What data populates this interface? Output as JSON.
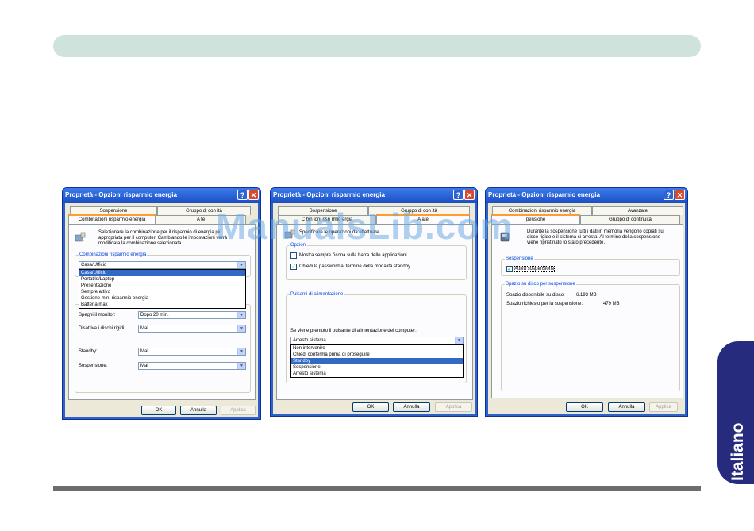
{
  "page": {
    "side_tab_label": "Italiano",
    "watermark": "ManualsLib.com"
  },
  "colors": {
    "top_bar": "#cfe3dc",
    "side_tab": "#262b7e",
    "titlebar": "#2f62c8",
    "highlight": "#316ac5"
  },
  "dialogs": [
    {
      "title": "Proprietà - Opzioni risparmio energia",
      "tabs_back": [
        "Sospensione",
        "Gruppo di con   ità"
      ],
      "tabs_front": [
        "Combinazioni risparmio energia",
        "A    te"
      ],
      "intro": [
        "Selezionare la combinazione per il risparmio di energia più",
        "appropriata per il computer. Cambiando le impostazioni verrà",
        "modificata la combinazione selezionata."
      ],
      "group_label": "Combinazioni risparmio energia",
      "combo_value": "Casa/Ufficio",
      "dropdown": [
        "Casa/Ufficio",
        "Portatile/Laptop",
        "Presentazione",
        "Sempre attivo",
        "Gestione min. risparmio energia",
        "Batteria max"
      ],
      "settings": [
        {
          "label": "Spegni il monitor:",
          "value": "Dopo 20 min."
        },
        {
          "label": "Disattiva i dischi rigidi:",
          "value": "Mai"
        },
        {
          "label": "Standby:",
          "value": "Mai"
        },
        {
          "label": "Sospensione:",
          "value": "Mai"
        }
      ],
      "buttons": [
        "OK",
        "Annulla",
        "Applica"
      ]
    },
    {
      "title": "Proprietà - Opzioni risparmio energia",
      "tabs_back": [
        "Sospensione",
        "Gruppo di con  ità"
      ],
      "tabs_front": [
        "C   bin  ioni risp  rmio   ergia",
        "A    ate"
      ],
      "intro": "Specificare le operazioni da effettuare.",
      "group_options": "Opzioni",
      "checkboxes": [
        {
          "label": "Mostra sempre l'icona sulla barra delle applicazioni.",
          "checked": false
        },
        {
          "label": "Chiedi la password al termine della modalità standby.",
          "checked": true
        }
      ],
      "group_power": "Pulsanti di alimentazione",
      "power_prompt": "Se viene premuto il pulsante di alimentazione del computer:",
      "combo_value": "Arresto sistema",
      "dropdown": [
        "Non intervenire",
        "Chiedi conferma prima di proseguire",
        "Standby",
        "Sospensione",
        "Arresto sistema"
      ],
      "dropdown_selected": "Standby",
      "buttons": [
        "OK",
        "Annulla",
        "Applica"
      ]
    },
    {
      "title": "Proprietà - Opzioni risparmio energia",
      "tabs_back": [
        "Combinazioni risparmio energia",
        "Avanzate"
      ],
      "tabs_front": [
        "    pensione",
        "Gruppo di continuità"
      ],
      "intro": [
        "Durante la sospensione tutti i dati in memoria vengono copiati sul",
        "disco rigido e il sistema si arresta. Al termine della sospensione",
        "viene ripristinato lo stato precedente."
      ],
      "group_susp": "Sospensione",
      "checkbox": {
        "label": "Attiva sospensione",
        "checked": true
      },
      "group_space": "Spazio su disco per sospensione",
      "space_free_label": "Spazio disponibile su disco:",
      "space_free_value": "6.193 MB",
      "space_req_label": "Spazio richiesto per la sospensione:",
      "space_req_value": "479 MB",
      "buttons": [
        "OK",
        "Annulla",
        "Applica"
      ]
    }
  ]
}
